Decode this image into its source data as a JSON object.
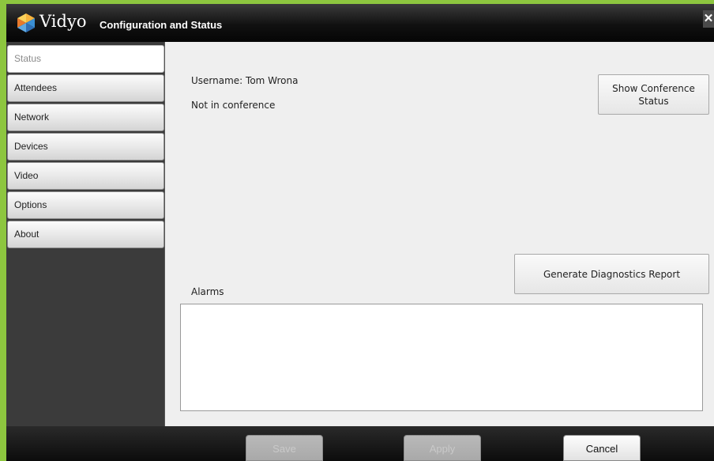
{
  "window": {
    "brand": "Vidyo",
    "title": "Configuration and Status",
    "close_glyph": "✕"
  },
  "sidebar": {
    "items": [
      {
        "label": "Status",
        "active": true
      },
      {
        "label": "Attendees",
        "active": false
      },
      {
        "label": "Network",
        "active": false
      },
      {
        "label": "Devices",
        "active": false
      },
      {
        "label": "Video",
        "active": false
      },
      {
        "label": "Options",
        "active": false
      },
      {
        "label": "About",
        "active": false
      }
    ]
  },
  "status": {
    "username": "Username: Tom Wrona",
    "conference_state": "Not in conference",
    "show_conference_button": "Show Conference Status",
    "diagnostics_button": "Generate Diagnostics Report",
    "alarms_label": "Alarms"
  },
  "footer": {
    "save_label": "Save",
    "apply_label": "Apply",
    "cancel_label": "Cancel"
  },
  "icons": {
    "logo": "vidyo-logo-icon",
    "close": "close-icon"
  },
  "colors": {
    "outer_frame": "#8dc63f",
    "titlebar": "#111111",
    "sidebar": "#3b3b3b",
    "content_bg": "#efefef"
  }
}
